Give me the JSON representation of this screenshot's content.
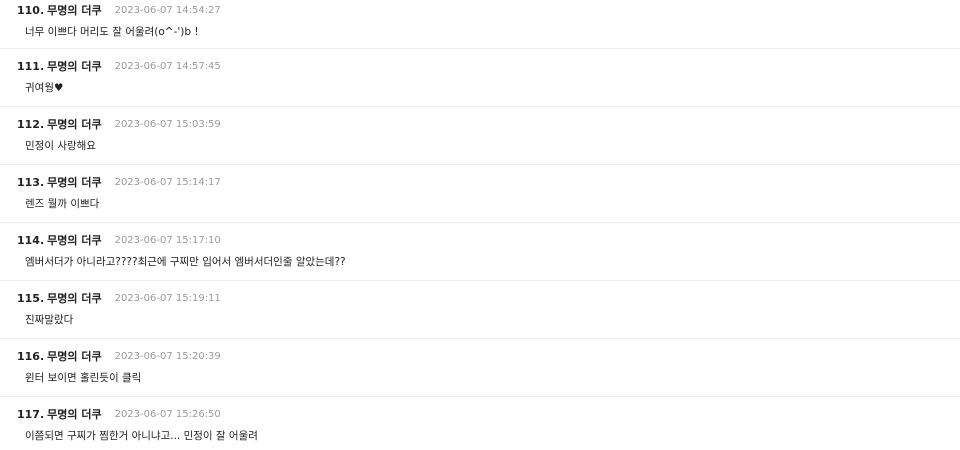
{
  "comments": [
    {
      "num": "110.",
      "author": "무명의 더쿠",
      "time": "2023-06-07 14:54:27",
      "text": "너무 이쁘다 머리도 잘 어울려(o^-')b !"
    },
    {
      "num": "111.",
      "author": "무명의 더쿠",
      "time": "2023-06-07 14:57:45",
      "text": "귀여웡♥"
    },
    {
      "num": "112.",
      "author": "무명의 더쿠",
      "time": "2023-06-07 15:03:59",
      "text": "민정이 사랑해요"
    },
    {
      "num": "113.",
      "author": "무명의 더쿠",
      "time": "2023-06-07 15:14:17",
      "text": "렌즈 뭘까 이쁘다"
    },
    {
      "num": "114.",
      "author": "무명의 더쿠",
      "time": "2023-06-07 15:17:10",
      "text": "엠버서더가 아니라고????최근에 구찌만 입어서 엠버서더인줄 알았는데??"
    },
    {
      "num": "115.",
      "author": "무명의 더쿠",
      "time": "2023-06-07 15:19:11",
      "text": "진짜말랐다"
    },
    {
      "num": "116.",
      "author": "무명의 더쿠",
      "time": "2023-06-07 15:20:39",
      "text": "윈터 보이면 홀린듯이 클릭"
    },
    {
      "num": "117.",
      "author": "무명의 더쿠",
      "time": "2023-06-07 15:26:50",
      "text": "이쯤되면 구찌가 찜한거 아니냐고... 민정이 잘 어울려"
    }
  ]
}
